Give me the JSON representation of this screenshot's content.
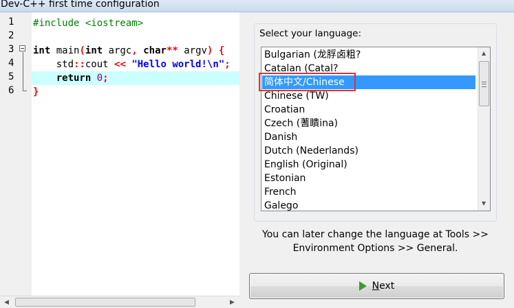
{
  "window": {
    "title": "Dev-C++ first time configuration"
  },
  "editor": {
    "line_numbers": [
      "1",
      "2",
      "3",
      "4",
      "5",
      "6"
    ],
    "lines": [
      [
        {
          "t": "#include <iostream>",
          "c": "pp"
        }
      ],
      [],
      [
        {
          "t": "int",
          "c": "kw"
        },
        {
          "t": " main",
          "c": "plain"
        },
        {
          "t": "(",
          "c": "op"
        },
        {
          "t": "int",
          "c": "kw"
        },
        {
          "t": " argc",
          "c": "plain"
        },
        {
          "t": ",",
          "c": "op"
        },
        {
          "t": " ",
          "c": "plain"
        },
        {
          "t": "char",
          "c": "kw"
        },
        {
          "t": "**",
          "c": "op"
        },
        {
          "t": " argv",
          "c": "plain"
        },
        {
          "t": ")",
          "c": "op"
        },
        {
          "t": " {",
          "c": "op"
        }
      ],
      [
        {
          "t": "    std",
          "c": "plain"
        },
        {
          "t": "::",
          "c": "op"
        },
        {
          "t": "cout ",
          "c": "plain"
        },
        {
          "t": "<<",
          "c": "op"
        },
        {
          "t": " ",
          "c": "plain"
        },
        {
          "t": "\"Hello world!\\n\"",
          "c": "str"
        },
        {
          "t": ";",
          "c": "op"
        }
      ],
      [
        {
          "t": "    ",
          "c": "plain"
        },
        {
          "t": "return",
          "c": "kw"
        },
        {
          "t": " ",
          "c": "plain"
        },
        {
          "t": "0",
          "c": "num"
        },
        {
          "t": ";",
          "c": "op"
        }
      ],
      [
        {
          "t": "}",
          "c": "op"
        }
      ]
    ]
  },
  "language_panel": {
    "label": "Select your language:",
    "items": [
      "Bulgarian (龙脬卤粗?",
      "Catalan (Catal?",
      "简体中文/Chinese",
      "Chinese (TW)",
      "Croatian",
      "Czech (蓍瞶ina)",
      "Danish",
      "Dutch (Nederlands)",
      "English (Original)",
      "Estonian",
      "French",
      "Galego"
    ],
    "selected_index": 2,
    "note": "You can later change the language at Tools >> Environment Options >> General."
  },
  "next_button": {
    "mnemonic": "N",
    "rest": "ext"
  }
}
